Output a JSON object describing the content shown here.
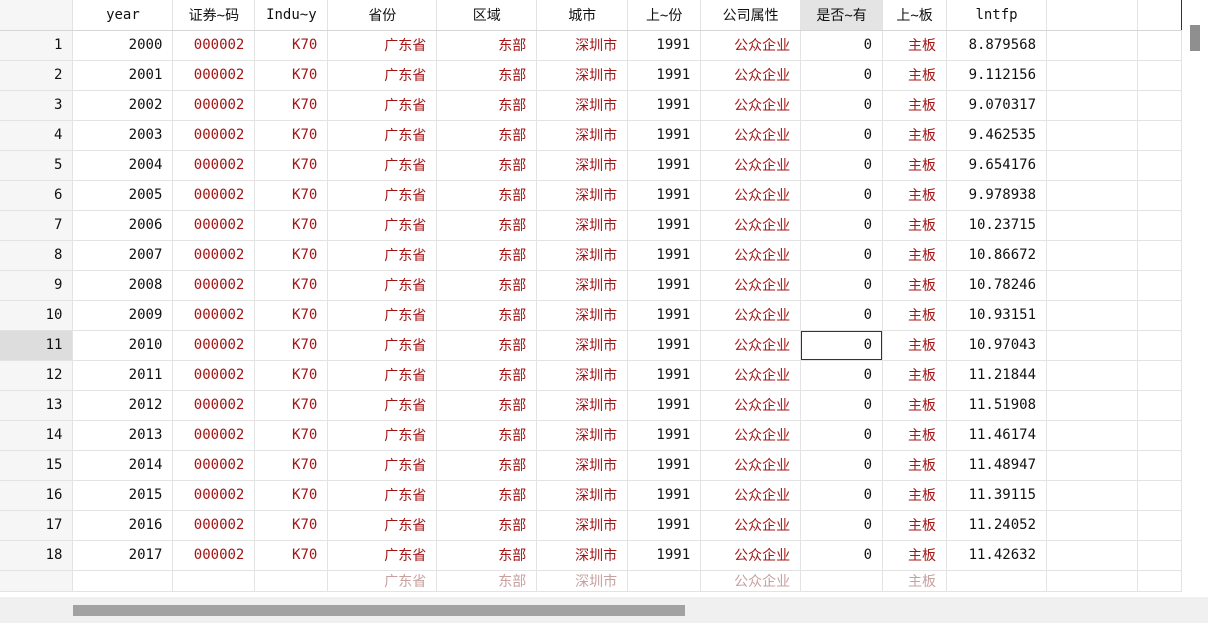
{
  "columns": [
    "",
    "year",
    "证券~码",
    "Indu~y",
    "省份",
    "区域",
    "城市",
    "上~份",
    "公司属性",
    "是否~有",
    "上~板",
    "lntfp",
    "",
    ""
  ],
  "rows": [
    {
      "n": "1",
      "year": "2000",
      "code": "000002",
      "ind": "K70",
      "prov": "广东省",
      "region": "东部",
      "city": "深圳市",
      "list_year": "1991",
      "attr": "公众企业",
      "flag": "0",
      "board": "主板",
      "lntfp": "8.879568"
    },
    {
      "n": "2",
      "year": "2001",
      "code": "000002",
      "ind": "K70",
      "prov": "广东省",
      "region": "东部",
      "city": "深圳市",
      "list_year": "1991",
      "attr": "公众企业",
      "flag": "0",
      "board": "主板",
      "lntfp": "9.112156"
    },
    {
      "n": "3",
      "year": "2002",
      "code": "000002",
      "ind": "K70",
      "prov": "广东省",
      "region": "东部",
      "city": "深圳市",
      "list_year": "1991",
      "attr": "公众企业",
      "flag": "0",
      "board": "主板",
      "lntfp": "9.070317"
    },
    {
      "n": "4",
      "year": "2003",
      "code": "000002",
      "ind": "K70",
      "prov": "广东省",
      "region": "东部",
      "city": "深圳市",
      "list_year": "1991",
      "attr": "公众企业",
      "flag": "0",
      "board": "主板",
      "lntfp": "9.462535"
    },
    {
      "n": "5",
      "year": "2004",
      "code": "000002",
      "ind": "K70",
      "prov": "广东省",
      "region": "东部",
      "city": "深圳市",
      "list_year": "1991",
      "attr": "公众企业",
      "flag": "0",
      "board": "主板",
      "lntfp": "9.654176"
    },
    {
      "n": "6",
      "year": "2005",
      "code": "000002",
      "ind": "K70",
      "prov": "广东省",
      "region": "东部",
      "city": "深圳市",
      "list_year": "1991",
      "attr": "公众企业",
      "flag": "0",
      "board": "主板",
      "lntfp": "9.978938"
    },
    {
      "n": "7",
      "year": "2006",
      "code": "000002",
      "ind": "K70",
      "prov": "广东省",
      "region": "东部",
      "city": "深圳市",
      "list_year": "1991",
      "attr": "公众企业",
      "flag": "0",
      "board": "主板",
      "lntfp": "10.23715"
    },
    {
      "n": "8",
      "year": "2007",
      "code": "000002",
      "ind": "K70",
      "prov": "广东省",
      "region": "东部",
      "city": "深圳市",
      "list_year": "1991",
      "attr": "公众企业",
      "flag": "0",
      "board": "主板",
      "lntfp": "10.86672"
    },
    {
      "n": "9",
      "year": "2008",
      "code": "000002",
      "ind": "K70",
      "prov": "广东省",
      "region": "东部",
      "city": "深圳市",
      "list_year": "1991",
      "attr": "公众企业",
      "flag": "0",
      "board": "主板",
      "lntfp": "10.78246"
    },
    {
      "n": "10",
      "year": "2009",
      "code": "000002",
      "ind": "K70",
      "prov": "广东省",
      "region": "东部",
      "city": "深圳市",
      "list_year": "1991",
      "attr": "公众企业",
      "flag": "0",
      "board": "主板",
      "lntfp": "10.93151"
    },
    {
      "n": "11",
      "year": "2010",
      "code": "000002",
      "ind": "K70",
      "prov": "广东省",
      "region": "东部",
      "city": "深圳市",
      "list_year": "1991",
      "attr": "公众企业",
      "flag": "0",
      "board": "主板",
      "lntfp": "10.97043"
    },
    {
      "n": "12",
      "year": "2011",
      "code": "000002",
      "ind": "K70",
      "prov": "广东省",
      "region": "东部",
      "city": "深圳市",
      "list_year": "1991",
      "attr": "公众企业",
      "flag": "0",
      "board": "主板",
      "lntfp": "11.21844"
    },
    {
      "n": "13",
      "year": "2012",
      "code": "000002",
      "ind": "K70",
      "prov": "广东省",
      "region": "东部",
      "city": "深圳市",
      "list_year": "1991",
      "attr": "公众企业",
      "flag": "0",
      "board": "主板",
      "lntfp": "11.51908"
    },
    {
      "n": "14",
      "year": "2013",
      "code": "000002",
      "ind": "K70",
      "prov": "广东省",
      "region": "东部",
      "city": "深圳市",
      "list_year": "1991",
      "attr": "公众企业",
      "flag": "0",
      "board": "主板",
      "lntfp": "11.46174"
    },
    {
      "n": "15",
      "year": "2014",
      "code": "000002",
      "ind": "K70",
      "prov": "广东省",
      "region": "东部",
      "city": "深圳市",
      "list_year": "1991",
      "attr": "公众企业",
      "flag": "0",
      "board": "主板",
      "lntfp": "11.48947"
    },
    {
      "n": "16",
      "year": "2015",
      "code": "000002",
      "ind": "K70",
      "prov": "广东省",
      "region": "东部",
      "city": "深圳市",
      "list_year": "1991",
      "attr": "公众企业",
      "flag": "0",
      "board": "主板",
      "lntfp": "11.39115"
    },
    {
      "n": "17",
      "year": "2016",
      "code": "000002",
      "ind": "K70",
      "prov": "广东省",
      "region": "东部",
      "city": "深圳市",
      "list_year": "1991",
      "attr": "公众企业",
      "flag": "0",
      "board": "主板",
      "lntfp": "11.24052"
    },
    {
      "n": "18",
      "year": "2017",
      "code": "000002",
      "ind": "K70",
      "prov": "广东省",
      "region": "东部",
      "city": "深圳市",
      "list_year": "1991",
      "attr": "公众企业",
      "flag": "0",
      "board": "主板",
      "lntfp": "11.42632"
    }
  ],
  "partial_row": {
    "prov": "广东省",
    "region": "东部",
    "city": "深圳市",
    "attr": "公众企业",
    "board": "主板"
  },
  "selection": {
    "row": "11",
    "column": "是否~有"
  },
  "colors": {
    "string_value": "#a31515",
    "numeric_value": "#111111",
    "header_highlight": "#e4e4e4",
    "rownum_bg": "#f6f6f6"
  }
}
